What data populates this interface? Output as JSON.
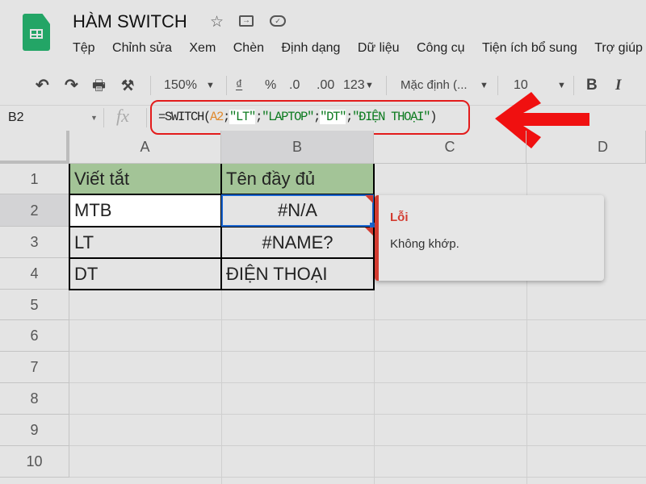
{
  "title": "HÀM SWITCH",
  "menu": [
    "Tệp",
    "Chỉnh sửa",
    "Xem",
    "Chèn",
    "Định dạng",
    "Dữ liệu",
    "Công cụ",
    "Tiện ích bổ sung",
    "Trợ giúp"
  ],
  "toolbar": {
    "zoom": "150%",
    "currency": "₫",
    "percent": "%",
    "dec_less": ".0",
    "dec_more": ".00",
    "format": "123",
    "font": "Mặc định (...",
    "size": "10",
    "bold": "B",
    "italic": "I"
  },
  "formula_bar": {
    "name_box": "B2",
    "fx": "fx",
    "formula": {
      "p1": "=SWITCH(",
      "ref": "A2",
      "s1": ";",
      "lt": "\"LT\"",
      "s2": ";",
      "laptop": "\"LAPTOP\"",
      "s3": ";",
      "dt": "\"DT\"",
      "s4": ";",
      "dienthoai": "\"ĐIỆN THOẠI\"",
      "end": ")"
    }
  },
  "columns": [
    "A",
    "B",
    "C",
    "D"
  ],
  "rows": [
    "1",
    "2",
    "3",
    "4",
    "5",
    "6",
    "7",
    "8",
    "9",
    "10"
  ],
  "cells": {
    "A1": "Viết tắt",
    "B1": "Tên đầy đủ",
    "A2": "MTB",
    "B2": "#N/A",
    "A3": "LT",
    "B3": "#NAME?",
    "A4": "DT",
    "B4": "ĐIỆN THOẠI"
  },
  "tooltip": {
    "title": "Lỗi",
    "message": "Không khớp."
  },
  "colors": {
    "header_fill": "#a3c497",
    "error": "#d33b30",
    "selection": "#1a66d2",
    "annotation": "#e31b1b"
  }
}
